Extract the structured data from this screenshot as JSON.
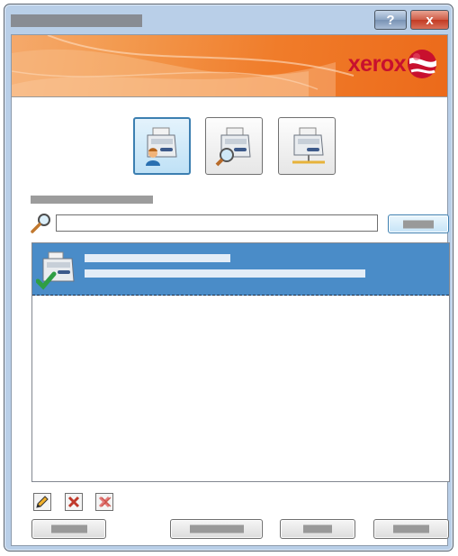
{
  "window": {
    "title": "",
    "help_label": "?",
    "close_label": "x"
  },
  "banner": {
    "brand": "xerox",
    "brand_color": "#c8102e",
    "accent_color": "#f07c2a"
  },
  "modes": [
    {
      "icon": "printer-user-icon",
      "selected": true
    },
    {
      "icon": "printer-search-icon",
      "selected": false
    },
    {
      "icon": "printer-network-icon",
      "selected": false
    }
  ],
  "search": {
    "label": "",
    "value": "",
    "placeholder": "",
    "button_label": ""
  },
  "printers": [
    {
      "name": "",
      "description": "",
      "status": "ok",
      "selected": true
    }
  ],
  "tools": [
    {
      "icon": "edit-pencil-icon"
    },
    {
      "icon": "delete-x-icon"
    },
    {
      "icon": "delete-all-icon"
    }
  ],
  "actions": {
    "left": "",
    "middle1": "",
    "middle2": "",
    "right": ""
  },
  "colors": {
    "selection": "#4a8cc8",
    "frame": "#b9cfe8"
  }
}
